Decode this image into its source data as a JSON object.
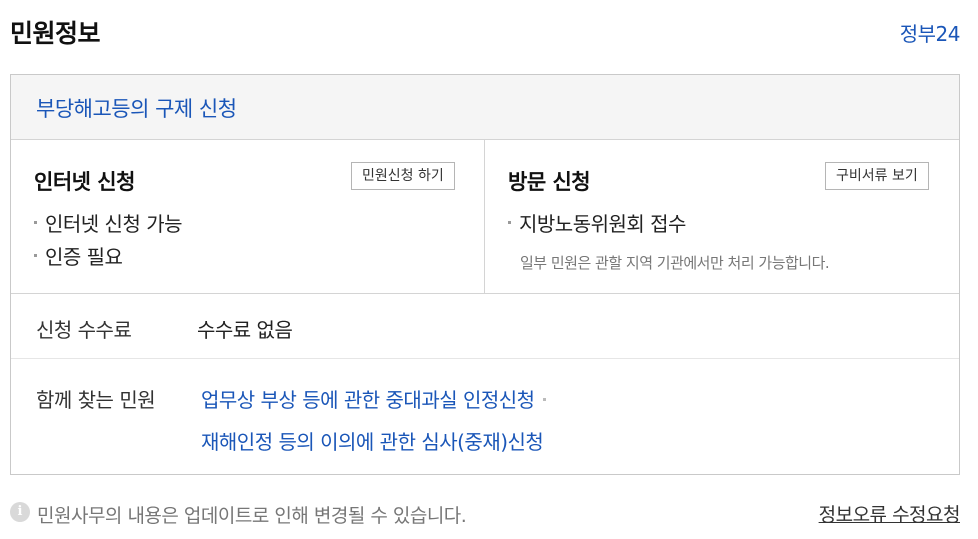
{
  "header": {
    "title": "민원정보",
    "gov_link": "정부24"
  },
  "service": {
    "title": "부당해고등의 구제 신청"
  },
  "internet": {
    "title": "인터넷 신청",
    "button": "민원신청 하기",
    "bullets": [
      "인터넷 신청 가능",
      "인증 필요"
    ]
  },
  "visit": {
    "title": "방문 신청",
    "button": "구비서류 보기",
    "bullets": [
      "지방노동위원회 접수"
    ],
    "note": "일부 민원은 관할 지역 기관에서만 처리 가능합니다."
  },
  "fee": {
    "label": "신청 수수료",
    "value": "수수료 없음"
  },
  "related": {
    "label": "함께 찾는 민원",
    "links": [
      "업무상 부상 등에 관한 중대과실 인정신청",
      "재해인정 등의 이의에 관한 심사(중재)신청"
    ]
  },
  "footer": {
    "info_icon": "info-circle-icon",
    "note": "민원사무의 내용은 업데이트로 인해 변경될 수 있습니다.",
    "report_link": "정보오류 수정요청"
  }
}
